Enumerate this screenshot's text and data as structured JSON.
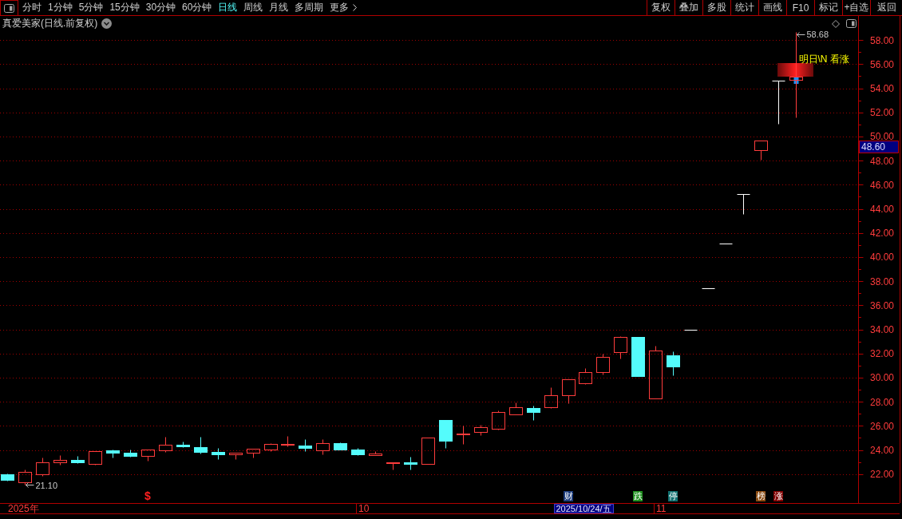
{
  "toolbar": {
    "periods": [
      {
        "label": "分时",
        "kind": "period",
        "selected": false
      },
      {
        "label": "1分钟",
        "kind": "period",
        "selected": false
      },
      {
        "label": "5分钟",
        "kind": "period",
        "selected": false
      },
      {
        "label": "15分钟",
        "kind": "period",
        "selected": false
      },
      {
        "label": "30分钟",
        "kind": "period",
        "selected": false
      },
      {
        "label": "60分钟",
        "kind": "period",
        "selected": false
      },
      {
        "label": "日线",
        "kind": "period",
        "selected": true
      },
      {
        "label": "周线",
        "kind": "period",
        "selected": false
      },
      {
        "label": "月线",
        "kind": "period",
        "selected": false
      },
      {
        "label": "多周期",
        "kind": "period",
        "selected": false
      },
      {
        "label": "更多",
        "kind": "menu",
        "selected": false
      }
    ],
    "tools": [
      "复权",
      "叠加",
      "多股",
      "统计",
      "画线",
      "F10",
      "标记",
      "+自选",
      "返回"
    ]
  },
  "chart_title": "真爱美家(日线.前复权)",
  "price_chart": {
    "chart_data": [
      {
        "type": "candlestick",
        "ohlc": [
          [
            22.0,
            22.05,
            21.45,
            21.55
          ],
          [
            21.35,
            22.4,
            21.1,
            22.2
          ],
          [
            22.0,
            23.4,
            21.85,
            23.0
          ],
          [
            22.97,
            23.6,
            22.8,
            23.15
          ],
          [
            23.15,
            23.5,
            22.9,
            22.95
          ],
          [
            22.82,
            23.9,
            22.75,
            23.89
          ],
          [
            24.0,
            24.05,
            23.38,
            23.74
          ],
          [
            23.74,
            24.04,
            23.45,
            23.52
          ],
          [
            23.52,
            24.07,
            23.08,
            24.07
          ],
          [
            24.0,
            25.1,
            23.85,
            24.44
          ],
          [
            24.44,
            24.7,
            24.22,
            24.3
          ],
          [
            24.26,
            25.1,
            23.7,
            23.85
          ],
          [
            23.85,
            24.15,
            23.23,
            23.63
          ],
          [
            23.67,
            23.75,
            23.23,
            23.74
          ],
          [
            23.78,
            24.1,
            23.38,
            24.1
          ],
          [
            24.04,
            24.6,
            23.9,
            24.51
          ],
          [
            24.44,
            25.14,
            24.33,
            24.5
          ],
          [
            24.4,
            24.9,
            23.93,
            24.15
          ],
          [
            23.96,
            24.9,
            23.63,
            24.55
          ],
          [
            24.6,
            24.66,
            24.07,
            24.07
          ],
          [
            24.07,
            24.15,
            23.56,
            23.67
          ],
          [
            23.6,
            23.93,
            23.56,
            23.7
          ],
          [
            22.93,
            23.0,
            22.38,
            23.0
          ],
          [
            23.0,
            23.45,
            22.38,
            22.86
          ],
          [
            22.86,
            25.03,
            22.86,
            25.03
          ],
          [
            26.5,
            26.5,
            24.15,
            24.77
          ],
          [
            25.29,
            26.0,
            24.48,
            25.36
          ],
          [
            25.5,
            26.1,
            25.21,
            25.87
          ],
          [
            25.73,
            27.3,
            25.7,
            27.12
          ],
          [
            26.94,
            27.97,
            26.94,
            27.57
          ],
          [
            27.46,
            27.68,
            26.46,
            27.12
          ],
          [
            27.53,
            29.18,
            27.5,
            28.56
          ],
          [
            28.56,
            29.88,
            27.86,
            29.88
          ],
          [
            29.55,
            30.76,
            29.5,
            30.47
          ],
          [
            30.47,
            31.98,
            30.25,
            31.72
          ],
          [
            32.12,
            33.45,
            31.57,
            33.38
          ],
          [
            33.38,
            33.4,
            30.14,
            30.14
          ],
          [
            28.3,
            32.64,
            28.3,
            32.24
          ],
          [
            31.87,
            32.2,
            30.18,
            30.9
          ],
          [
            33.99,
            33.99,
            33.99,
            33.99
          ],
          [
            37.39,
            37.39,
            37.39,
            37.39
          ],
          [
            41.13,
            41.13,
            41.13,
            41.13
          ],
          [
            45.24,
            45.24,
            43.6,
            45.24
          ],
          [
            48.85,
            49.68,
            48.05,
            49.68
          ],
          [
            54.65,
            54.65,
            51.04,
            54.65
          ],
          [
            54.68,
            58.68,
            51.6,
            54.95
          ],
          null,
          null,
          null
        ],
        "ylim": [
          19.6,
          60
        ],
        "yticks": [
          {
            "value": 22,
            "label": "22.00"
          },
          {
            "value": 24,
            "label": "24.00"
          },
          {
            "value": 26,
            "label": "26.00"
          },
          {
            "value": 28,
            "label": "28.00"
          },
          {
            "value": 30,
            "label": "30.00"
          },
          {
            "value": 32,
            "label": "32.00"
          },
          {
            "value": 34,
            "label": "34.00"
          },
          {
            "value": 36,
            "label": "36.00"
          },
          {
            "value": 38,
            "label": "38.00"
          },
          {
            "value": 40,
            "label": "40.00"
          },
          {
            "value": 42,
            "label": "42.00"
          },
          {
            "value": 44,
            "label": "44.00"
          },
          {
            "value": 46,
            "label": "46.00"
          },
          {
            "value": 48,
            "label": "48.00"
          },
          {
            "value": 50,
            "label": "50.00"
          },
          {
            "value": 52,
            "label": "52.00"
          },
          {
            "value": 54,
            "label": "54.00"
          },
          {
            "value": 56,
            "label": "56.00"
          },
          {
            "value": 58,
            "label": "58.00"
          }
        ],
        "grid": true,
        "annotations": [
          "21.10",
          "58.68",
          "明日\\N 看涨"
        ]
      }
    ]
  },
  "event_markers": [
    {
      "label": "$",
      "kind": "glyph",
      "color": "#ff2020"
    },
    {
      "label": "财",
      "kind": "badge",
      "color": "#1c3c7c"
    },
    {
      "label": "跌",
      "kind": "badge",
      "color": "#1f8f1f"
    },
    {
      "label": "停",
      "kind": "badge",
      "color": "#107070"
    },
    {
      "label": "榜",
      "kind": "badge",
      "color": "#8a4a10"
    },
    {
      "label": "涨",
      "kind": "badge",
      "color": "#800000"
    }
  ],
  "time_axis": {
    "labels": [
      "2025年",
      "10",
      "11"
    ]
  },
  "cursor": {
    "price": "48.60",
    "date": "2025/10/24/五"
  }
}
